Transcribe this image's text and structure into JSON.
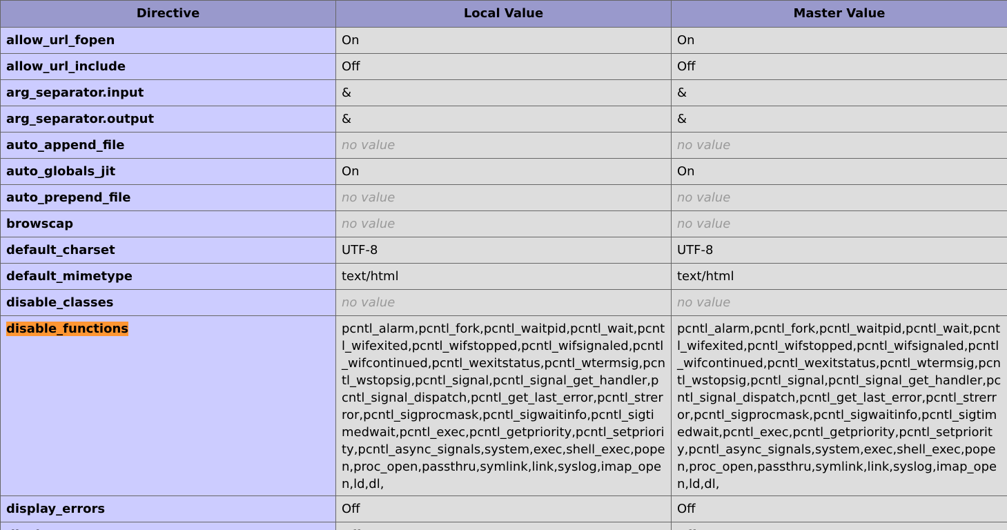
{
  "headers": {
    "directive": "Directive",
    "local": "Local Value",
    "master": "Master Value"
  },
  "rows": [
    {
      "name": "allow_url_fopen",
      "local": "On",
      "master": "On",
      "empty": false
    },
    {
      "name": "allow_url_include",
      "local": "Off",
      "master": "Off",
      "empty": false
    },
    {
      "name": "arg_separator.input",
      "local": "&",
      "master": "&",
      "empty": false
    },
    {
      "name": "arg_separator.output",
      "local": "&",
      "master": "&",
      "empty": false
    },
    {
      "name": "auto_append_file",
      "local": "no value",
      "master": "no value",
      "empty": true
    },
    {
      "name": "auto_globals_jit",
      "local": "On",
      "master": "On",
      "empty": false
    },
    {
      "name": "auto_prepend_file",
      "local": "no value",
      "master": "no value",
      "empty": true
    },
    {
      "name": "browscap",
      "local": "no value",
      "master": "no value",
      "empty": true
    },
    {
      "name": "default_charset",
      "local": "UTF-8",
      "master": "UTF-8",
      "empty": false
    },
    {
      "name": "default_mimetype",
      "local": "text/html",
      "master": "text/html",
      "empty": false
    },
    {
      "name": "disable_classes",
      "local": "no value",
      "master": "no value",
      "empty": true
    },
    {
      "name": "disable_functions",
      "highlighted": true,
      "local": "pcntl_alarm,pcntl_fork,pcntl_waitpid,pcntl_wait,pcntl_wifexited,pcntl_wifstopped,pcntl_wifsignaled,pcntl_wifcontinued,pcntl_wexitstatus,pcntl_wtermsig,pcntl_wstopsig,pcntl_signal,pcntl_signal_get_handler,pcntl_signal_dispatch,pcntl_get_last_error,pcntl_strerror,pcntl_sigprocmask,pcntl_sigwaitinfo,pcntl_sigtimedwait,pcntl_exec,pcntl_getpriority,pcntl_setpriority,pcntl_async_signals,system,exec,shell_exec,popen,proc_open,passthru,symlink,link,syslog,imap_open,ld,dl,",
      "master": "pcntl_alarm,pcntl_fork,pcntl_waitpid,pcntl_wait,pcntl_wifexited,pcntl_wifstopped,pcntl_wifsignaled,pcntl_wifcontinued,pcntl_wexitstatus,pcntl_wtermsig,pcntl_wstopsig,pcntl_signal,pcntl_signal_get_handler,pcntl_signal_dispatch,pcntl_get_last_error,pcntl_strerror,pcntl_sigprocmask,pcntl_sigwaitinfo,pcntl_sigtimedwait,pcntl_exec,pcntl_getpriority,pcntl_setpriority,pcntl_async_signals,system,exec,shell_exec,popen,proc_open,passthru,symlink,link,syslog,imap_open,ld,dl,",
      "empty": false
    },
    {
      "name": "display_errors",
      "local": "Off",
      "master": "Off",
      "empty": false
    },
    {
      "name": "display_startup_errors",
      "local": "Off",
      "master": "Off",
      "empty": false
    }
  ],
  "colors": {
    "header_bg": "#9999cc",
    "directive_bg": "#ccccff",
    "value_bg": "#dddddd",
    "highlight": "#ff9632",
    "novalue_text": "#999999"
  }
}
